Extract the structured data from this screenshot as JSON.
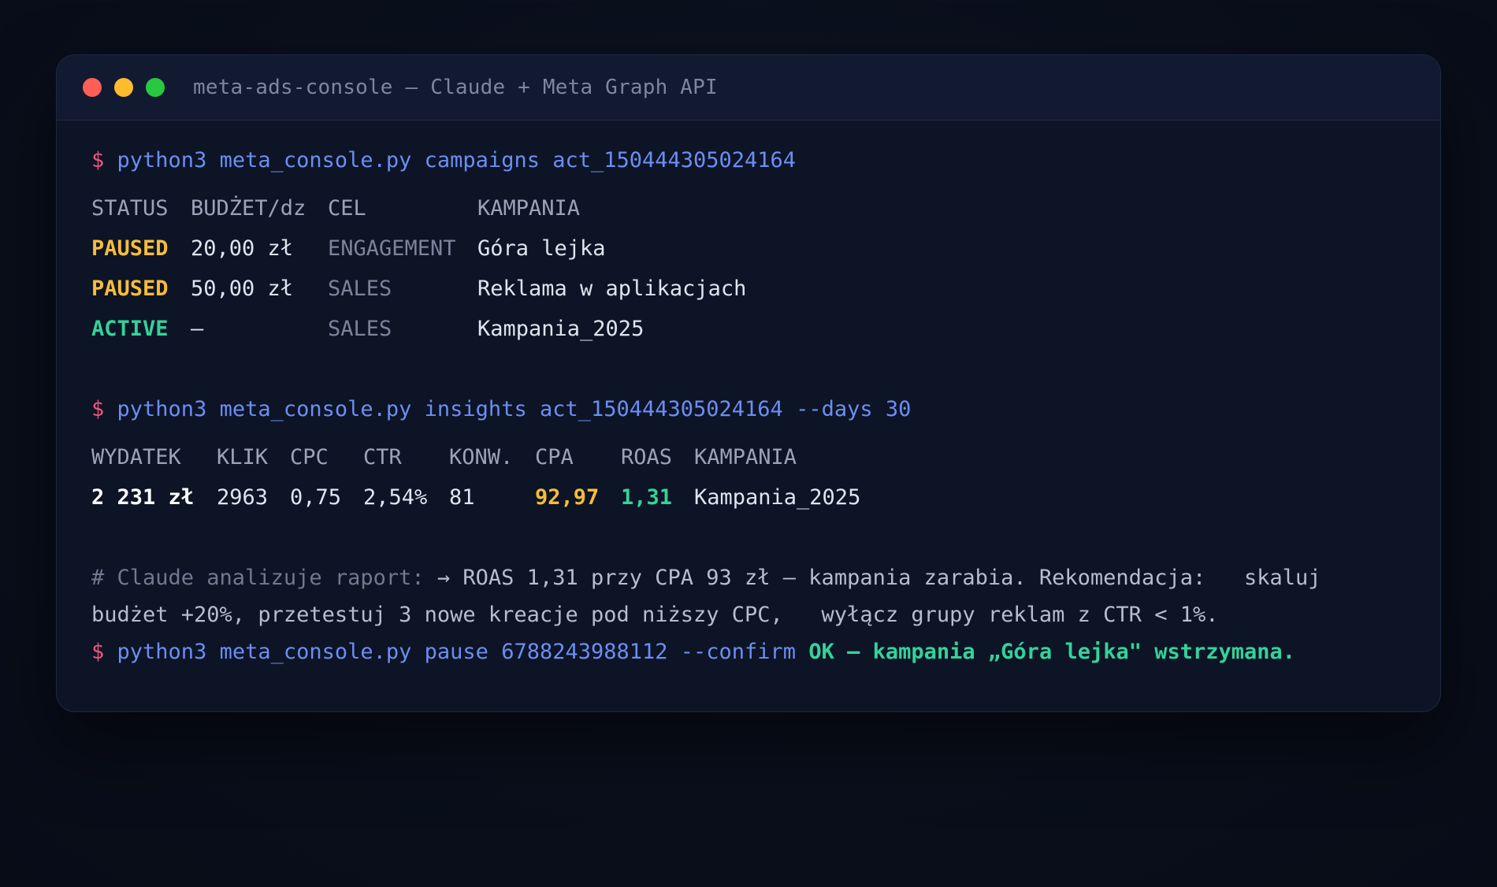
{
  "window": {
    "title": "meta-ads-console — Claude + Meta Graph API",
    "traffic_lights": {
      "close": "#ff5f57",
      "minimize": "#febc2e",
      "maximize": "#28c840"
    }
  },
  "prompt_symbol": "$",
  "campaigns": {
    "command": "python3 meta_console.py campaigns act_150444305024164",
    "headers": {
      "status": "STATUS",
      "budget": "BUDŻET/dz",
      "goal": "CEL",
      "campaign": "KAMPANIA"
    },
    "rows": [
      {
        "status": "PAUSED",
        "budget": "20,00 zł",
        "goal": "ENGAGEMENT",
        "campaign": "Góra lejka"
      },
      {
        "status": "PAUSED",
        "budget": "50,00 zł",
        "goal": "SALES",
        "campaign": "Reklama w aplikacjach"
      },
      {
        "status": "ACTIVE",
        "budget": "—",
        "goal": "SALES",
        "campaign": "Kampania_2025"
      }
    ]
  },
  "insights": {
    "command": "python3 meta_console.py insights act_150444305024164 --days 30",
    "headers": {
      "spend": "WYDATEK",
      "clicks": "KLIK",
      "cpc": "CPC",
      "ctr": "CTR",
      "conv": "KONW.",
      "cpa": "CPA",
      "roas": "ROAS",
      "campaign": "KAMPANIA"
    },
    "row": {
      "spend": "2 231 zł",
      "clicks": "2963",
      "cpc": "0,75",
      "ctr": "2,54%",
      "conv": "81",
      "cpa": "92,97",
      "roas": "1,31",
      "campaign": "Kampania_2025"
    }
  },
  "analysis": {
    "comment_prefix": "# Claude analizuje raport:",
    "line1": " → ROAS 1,31 przy CPA 93 zł — kampania zarabia. Rekomendacja:   skaluj",
    "line2": "budżet +20%, przetestuj 3 nowe kreacje pod niższy CPC,   wyłącz grupy reklam z CTR < 1%."
  },
  "pause": {
    "command": "python3 meta_console.py pause 6788243988112 --confirm",
    "result": "OK — kampania „Góra lejka\" wstrzymana."
  }
}
